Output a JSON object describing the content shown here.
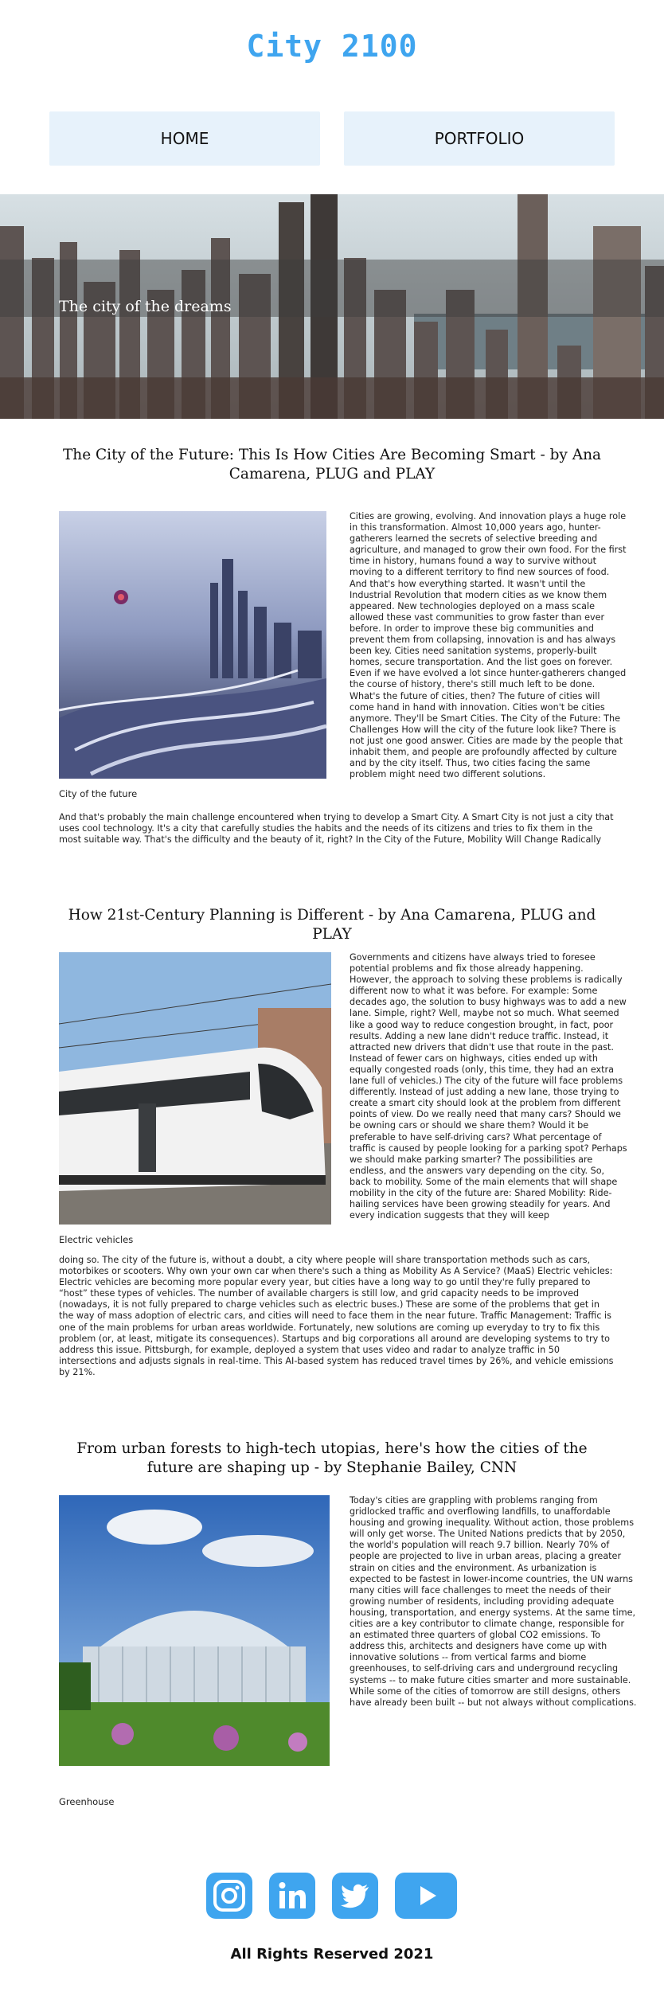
{
  "header": {
    "logo": "City 2100"
  },
  "nav": {
    "items": [
      {
        "label": "HOME"
      },
      {
        "label": "PORTFOLIO"
      }
    ]
  },
  "hero": {
    "text": "The city of the dreams"
  },
  "articles": [
    {
      "title": "The City of the Future: This Is How Cities Are Becoming Smart - by Ana Camarena, PLUG and PLAY",
      "caption": "City of the future",
      "body": "Cities are growing, evolving. And innovation plays a huge role in this transformation. Almost 10,000 years ago, hunter-gatherers learned the secrets of selective breeding and agriculture, and managed to grow their own food. For the first time in history, humans found a way to survive without moving to a different territory to find new sources of food. And that's how everything started. It wasn't until the Industrial Revolution that modern cities as we know them appeared. New technologies deployed on a mass scale allowed these vast communities to grow faster than ever before. In order to improve these big communities and prevent them from collapsing, innovation is and has always been key. Cities need sanitation systems, properly-built homes, secure transportation. And the list goes on forever. Even if we have evolved a lot since hunter-gatherers changed the course of history, there's still much left to be done. What's the future of cities, then? The future of cities will come hand in hand with innovation. Cities won't be cities anymore. They'll be Smart Cities. The City of the Future: The Challenges How will the city of the future look like? There is not just one good answer. Cities are made by the people that inhabit them, and people are profoundly affected by culture and by the city itself. Thus, two cities facing the same problem might  need two different solutions.",
      "tail": "And that's probably the main challenge encountered when trying to develop a Smart City. A Smart City is not just a city that uses cool technology. It's a city that carefully studies the habits and the needs of its citizens and tries to fix them in the most suitable way. That's the difficulty and the beauty of it, right? In the City of the Future, Mobility Will Change Radically"
    },
    {
      "title": "How 21st-Century Planning is Different - by Ana Camarena, PLUG and PLAY",
      "caption": "Electric vehicles",
      "body": "Governments and citizens have always tried to foresee potential problems and fix those already happening. However, the approach to solving these problems is radically different now to what it was before. For example: Some decades ago, the solution to busy highways was to add a new lane. Simple, right? Well, maybe not so much. What seemed like a good way to reduce congestion brought, in fact, poor results. Adding a new lane didn't reduce traffic. Instead, it attracted new drivers that didn't use that route in the past. Instead of fewer cars on highways, cities ended up with equally congested roads (only, this time, they had an extra lane full of vehicles.) The city of the future will face problems differently. Instead of just adding a new lane, those trying to create a smart city should look at the problem from different points of view. Do we really need that many cars? Should we be owning cars or should we share them? Would it be preferable to have self-driving cars? What percentage of traffic is caused by people looking for a parking spot? Perhaps we should make parking smarter? The possibilities are endless, and the answers vary depending on the city. So, back to mobility. Some of the main elements that will shape mobility in the city of the future are: Shared Mobility: Ride-hailing services have been growing steadily for years. And every indication suggests that they will keep",
      "tail": "doing so. The city of the future is, without a doubt, a city where people will share transportation methods such as cars, motorbikes or scooters. Why own your own car when there's such a thing as Mobility As A Service? (MaaS) Electric vehicles: Electric vehicles are becoming more popular every year, but cities have a long way to go until they're fully prepared to “host” these types of vehicles. The number of available chargers is still low, and grid capacity needs to be improved (nowadays, it is not fully prepared to charge vehicles such as electric buses.) These are some of the problems that get in the way of mass adoption of electric cars, and cities will need to face them in the near future. Traffic Management: Traffic is one of the main problems for urban areas worldwide. Fortunately, new solutions are coming up everyday to try to fix this problem (or, at least, mitigate its consequences). Startups and big corporations all around are developing systems to try to address this issue. Pittsburgh, for example, deployed a system that uses video and radar to analyze traffic in 50 intersections and adjusts signals in real-time. This AI-based system has reduced travel times by 26%, and vehicle emissions by 21%."
    },
    {
      "title": "From urban forests to high-tech utopias, here's how the cities of the future are shaping up - by Stephanie Bailey, CNN",
      "caption": "Greenhouse",
      "body": "Today's cities are grappling with problems ranging from gridlocked traffic and overflowing landfills, to unaffordable housing and growing inequality. Without action, those problems will only get worse. The United Nations predicts that by 2050, the world's population will reach 9.7 billion. Nearly 70% of people are projected to live in urban areas, placing a greater strain on cities and the environment. As urbanization is expected to be fastest in lower-income countries, the UN warns many cities will face challenges to meet the needs of their growing number of residents, including providing adequate housing, transportation, and energy systems. At the same time, cities are a key contributor to climate change, responsible for an estimated three quarters of global CO2 emissions. To address this, architects and designers have come up with innovative solutions -- from vertical farms and biome greenhouses, to self-driving cars and underground recycling systems -- to make future cities smarter and more sustainable. While some of the cities of tomorrow are still designs, others have already been built -- but not always without complications.",
      "tail": ""
    }
  ],
  "social": [
    {
      "icon": "instagram-icon"
    },
    {
      "icon": "linkedin-icon"
    },
    {
      "icon": "twitter-icon"
    },
    {
      "icon": "youtube-icon"
    }
  ],
  "footer": {
    "text": "All Rights Reserved 2021"
  },
  "colors": {
    "accent": "#3fa5ef",
    "nav_bg": "#e7f2fb"
  }
}
